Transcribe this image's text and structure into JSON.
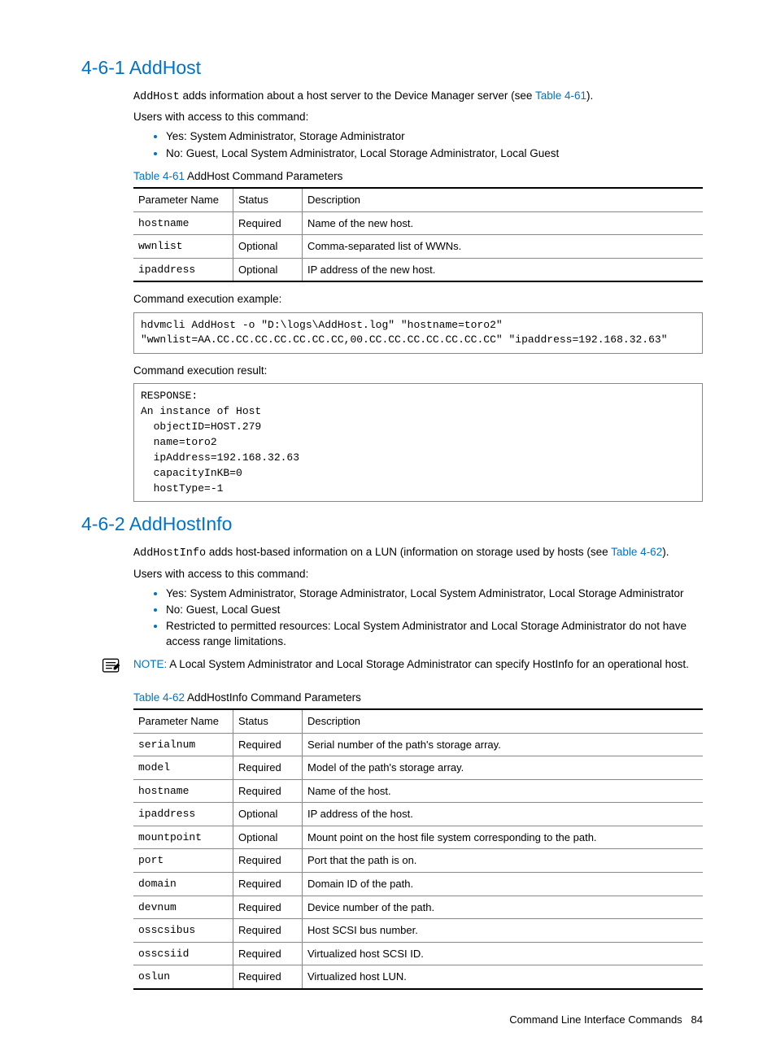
{
  "sec1": {
    "heading": "4-6-1 AddHost",
    "intro_cmd": "AddHost",
    "intro_rest": " adds information about a host server to the Device Manager server (see ",
    "intro_link": "Table 4-61",
    "intro_end": ").",
    "access_label": "Users with access to this command:",
    "access_items": [
      "Yes: System Administrator, Storage Administrator",
      "No: Guest, Local System Administrator, Local Storage Administrator, Local Guest"
    ],
    "table_link": "Table 4-61",
    "table_caption_rest": "  AddHost Command Parameters",
    "table_headers": [
      "Parameter Name",
      "Status",
      "Description"
    ],
    "table_rows": [
      {
        "p": "hostname",
        "s": "Required",
        "d": "Name of the new host."
      },
      {
        "p": "wwnlist",
        "s": "Optional",
        "d": "Comma-separated list of WWNs."
      },
      {
        "p": "ipaddress",
        "s": "Optional",
        "d": "IP address of the new host."
      }
    ],
    "exec_example_label": "Command execution example:",
    "exec_example_code": "hdvmcli AddHost -o \"D:\\logs\\AddHost.log\" \"hostname=toro2\" \"wwnlist=AA.CC.CC.CC.CC.CC.CC.CC,00.CC.CC.CC.CC.CC.CC.CC\" \"ipaddress=192.168.32.63\"",
    "exec_result_label": "Command execution result:",
    "exec_result_code": "RESPONSE:\nAn instance of Host\n  objectID=HOST.279\n  name=toro2\n  ipAddress=192.168.32.63\n  capacityInKB=0\n  hostType=-1"
  },
  "sec2": {
    "heading": "4-6-2 AddHostInfo",
    "intro_cmd": "AddHostInfo",
    "intro_rest": " adds host-based information on a LUN (information on storage used by hosts (see ",
    "intro_link": "Table 4-62",
    "intro_end": ").",
    "access_label": "Users with access to this command:",
    "access_items": [
      "Yes: System Administrator, Storage Administrator, Local System Administrator, Local Storage Administrator",
      "No: Guest, Local Guest",
      "Restricted to permitted resources: Local System Administrator and Local Storage Administrator do not have access range limitations."
    ],
    "note_label": "NOTE:  ",
    "note_text": "A Local System Administrator and Local Storage Administrator can specify HostInfo for an operational host.",
    "table_link": "Table 4-62",
    "table_caption_rest": "  AddHostInfo Command Parameters",
    "table_headers": [
      "Parameter Name",
      "Status",
      "Description"
    ],
    "table_rows": [
      {
        "p": "serialnum",
        "s": "Required",
        "d": "Serial number of the path's storage array."
      },
      {
        "p": "model",
        "s": "Required",
        "d": "Model of the path's storage array."
      },
      {
        "p": "hostname",
        "s": "Required",
        "d": "Name of the host."
      },
      {
        "p": "ipaddress",
        "s": "Optional",
        "d": "IP address of the host."
      },
      {
        "p": "mountpoint",
        "s": "Optional",
        "d": "Mount point on the host file system corresponding to the path."
      },
      {
        "p": "port",
        "s": "Required",
        "d": "Port that the path is on."
      },
      {
        "p": "domain",
        "s": "Required",
        "d": "Domain ID of the path."
      },
      {
        "p": "devnum",
        "s": "Required",
        "d": "Device number of the path."
      },
      {
        "p": "osscsibus",
        "s": "Required",
        "d": "Host SCSI bus number."
      },
      {
        "p": "osscsiid",
        "s": "Required",
        "d": "Virtualized host SCSI ID."
      },
      {
        "p": "oslun",
        "s": "Required",
        "d": "Virtualized host LUN."
      }
    ]
  },
  "footer": {
    "label": "Command Line Interface Commands",
    "page": "84"
  }
}
